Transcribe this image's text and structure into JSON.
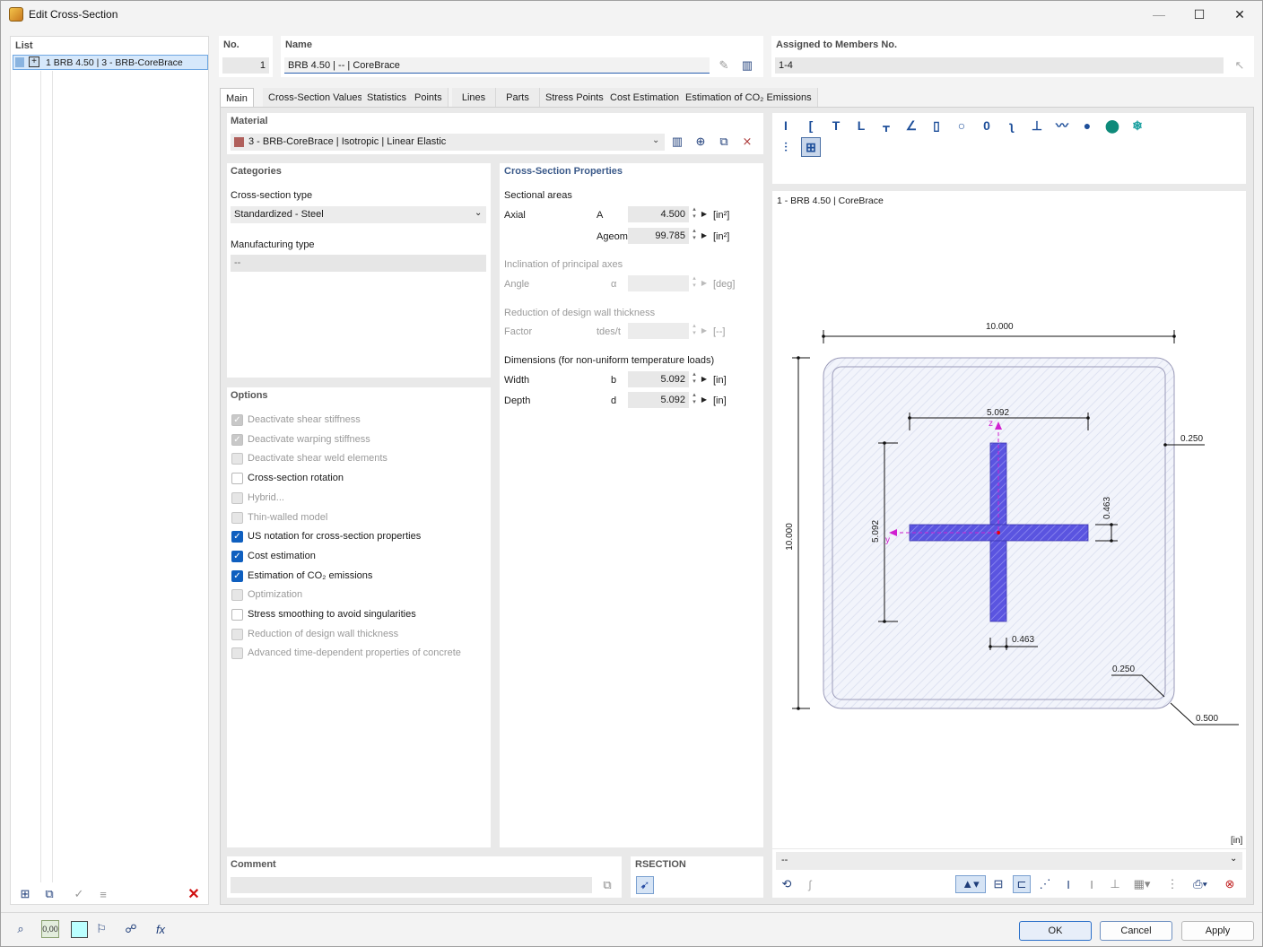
{
  "window": {
    "title": "Edit Cross-Section",
    "minimize": "—",
    "maximize": "☐",
    "close": "✕"
  },
  "list": {
    "header": "List",
    "items": [
      {
        "label": "1  BRB 4.50 | 3 - BRB-CoreBrace"
      }
    ]
  },
  "no": {
    "label": "No.",
    "value": "1"
  },
  "name": {
    "label": "Name",
    "value": "BRB 4.50 | -- | CoreBrace"
  },
  "assigned": {
    "label": "Assigned to Members No.",
    "value": "1-4"
  },
  "tabs": [
    "Main",
    "Cross-Section Values",
    "Statistics",
    "Points",
    "Lines",
    "Parts",
    "Stress Points",
    "Cost Estimation",
    "Estimation of CO₂ Emissions"
  ],
  "material": {
    "header": "Material",
    "value": "3 - BRB-CoreBrace | Isotropic | Linear Elastic",
    "swatch_color": "#b0605c"
  },
  "categories": {
    "header": "Categories",
    "cs_type_label": "Cross-section type",
    "cs_type_value": "Standardized - Steel",
    "mfg_label": "Manufacturing type",
    "mfg_value": "--"
  },
  "options": {
    "header": "Options",
    "items": [
      {
        "label": "Deactivate shear stiffness",
        "checked": true,
        "enabled": false
      },
      {
        "label": "Deactivate warping stiffness",
        "checked": true,
        "enabled": false
      },
      {
        "label": "Deactivate shear weld elements",
        "checked": false,
        "enabled": false
      },
      {
        "label": "Cross-section rotation",
        "checked": false,
        "enabled": true
      },
      {
        "label": "Hybrid...",
        "checked": false,
        "enabled": false
      },
      {
        "label": "Thin-walled model",
        "checked": false,
        "enabled": false
      },
      {
        "label": "US notation for cross-section properties",
        "checked": true,
        "enabled": true
      },
      {
        "label": "Cost estimation",
        "checked": true,
        "enabled": true
      },
      {
        "label": "Estimation of CO₂ emissions",
        "checked": true,
        "enabled": true
      },
      {
        "label": "Optimization",
        "checked": false,
        "enabled": false
      },
      {
        "label": "Stress smoothing to avoid singularities",
        "checked": false,
        "enabled": true
      },
      {
        "label": "Reduction of design wall thickness",
        "checked": false,
        "enabled": false
      },
      {
        "label": "Advanced time-dependent properties of concrete",
        "checked": false,
        "enabled": false
      }
    ]
  },
  "csprops": {
    "header": "Cross-Section Properties",
    "sectional_areas": "Sectional areas",
    "axial": "Axial",
    "A_sym": "A",
    "A_val": "4.500",
    "Ageom_sym": "Ageom",
    "Ageom_val": "99.785",
    "unit_area": "[in²]",
    "inclination": "Inclination of principal axes",
    "angle": "Angle",
    "alpha": "α",
    "unit_deg": "[deg]",
    "reduction": "Reduction of design wall thickness",
    "factor": "Factor",
    "tdes": "tdes/t",
    "unit_dash": "[--]",
    "dimensions": "Dimensions (for non-uniform temperature loads)",
    "width": "Width",
    "b_sym": "b",
    "b_val": "5.092",
    "depth": "Depth",
    "d_sym": "d",
    "d_val": "5.092",
    "unit_in": "[in]"
  },
  "preview": {
    "caption": "1 - BRB 4.50 | CoreBrace",
    "unit": "[in]",
    "combo": "--",
    "dims": {
      "outer_w": "10.000",
      "outer_h": "10.000",
      "inner_w": "5.092",
      "inner_h": "5.092",
      "wall": "0.250",
      "flange_t": "0.463",
      "web_t": "0.463",
      "r_in": "0.250",
      "r_out": "0.500",
      "z": "z",
      "y": "y"
    }
  },
  "comment": {
    "header": "Comment",
    "value": ""
  },
  "rsection": {
    "header": "RSECTION"
  },
  "buttons": {
    "ok": "OK",
    "cancel": "Cancel",
    "apply": "Apply"
  },
  "footer": {
    "units_label": "0,00"
  }
}
